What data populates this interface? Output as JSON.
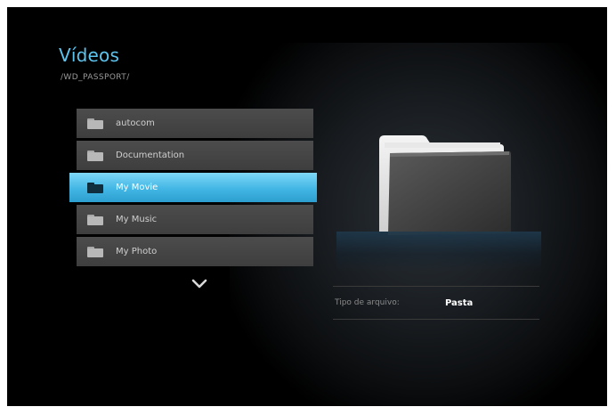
{
  "header": {
    "title": "Vídeos",
    "path": "/WD_PASSPORT/"
  },
  "file_list": {
    "items": [
      {
        "label": "autocom",
        "icon": "folder-icon",
        "selected": false
      },
      {
        "label": "Documentation",
        "icon": "folder-icon",
        "selected": false
      },
      {
        "label": "My Movie",
        "icon": "folder-icon",
        "selected": true
      },
      {
        "label": "My Music",
        "icon": "folder-icon",
        "selected": false
      },
      {
        "label": "My Photo",
        "icon": "folder-icon",
        "selected": false
      }
    ],
    "more_indicator_icon": "chevron-down-icon"
  },
  "preview": {
    "icon": "folder-icon"
  },
  "details": {
    "file_type_label": "Tipo de arquivo:",
    "file_type_value": "Pasta"
  },
  "colors": {
    "accent": "#42b6e4",
    "title": "#5cc4ee",
    "background": "#000000",
    "list_item": "#444444"
  }
}
